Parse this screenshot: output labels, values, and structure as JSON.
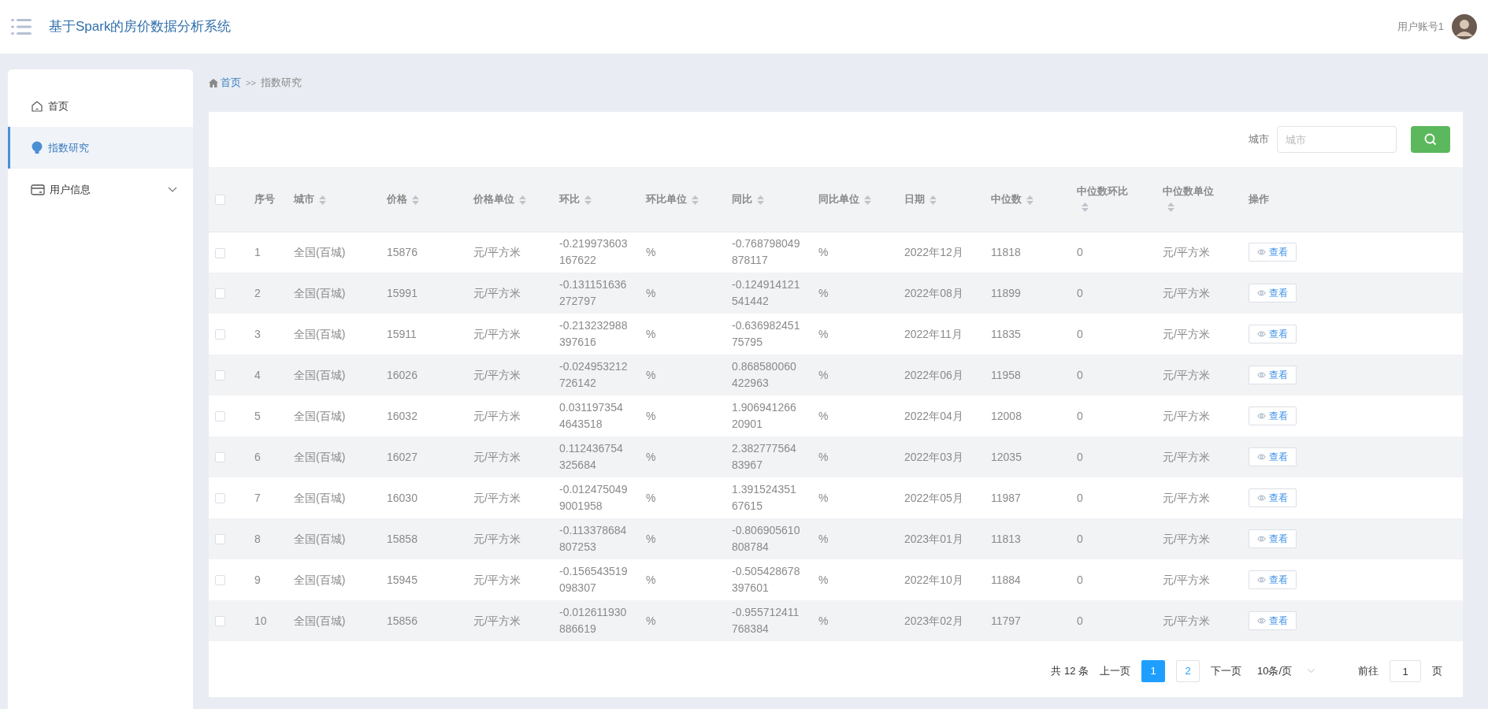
{
  "header": {
    "title": "基于Spark的房价数据分析系统",
    "user": "用户账号1"
  },
  "sidebar": {
    "items": [
      {
        "label": "首页",
        "selected": false
      },
      {
        "label": "指数研究",
        "selected": true
      },
      {
        "label": "用户信息",
        "selected": false,
        "expanded": false
      }
    ]
  },
  "breadcrumb": [
    {
      "label": "首页",
      "kind": "link"
    },
    {
      "label": "指数研究",
      "kind": "current"
    }
  ],
  "breadcrumb_separator": ">>",
  "search": {
    "label": "城市",
    "placeholder": "城市"
  },
  "table": {
    "all_checked": false,
    "columns": [
      {
        "label": "序号",
        "sortable": false
      },
      {
        "label": "城市",
        "sortable": true
      },
      {
        "label": "价格",
        "sortable": true
      },
      {
        "label": "价格单位",
        "sortable": true
      },
      {
        "label": "环比",
        "sortable": true
      },
      {
        "label": "环比单位",
        "sortable": true
      },
      {
        "label": "同比",
        "sortable": true
      },
      {
        "label": "同比单位",
        "sortable": true
      },
      {
        "label": "日期",
        "sortable": true
      },
      {
        "label": "中位数",
        "sortable": true
      },
      {
        "label": "中位数环比",
        "sortable": true
      },
      {
        "label": "中位数单位",
        "sortable": true
      },
      {
        "label": "操作",
        "sortable": false
      }
    ],
    "rows": [
      {
        "checked": false,
        "cells": [
          "1",
          "全国(百城)",
          "15876",
          "元/平方米",
          "-0.219973603167622",
          "%",
          "-0.768798049878117",
          "%",
          "2022年12月",
          "11818",
          "0",
          "元/平方米"
        ],
        "action": "查看"
      },
      {
        "checked": false,
        "cells": [
          "2",
          "全国(百城)",
          "15991",
          "元/平方米",
          "-0.131151636272797",
          "%",
          "-0.124914121541442",
          "%",
          "2022年08月",
          "11899",
          "0",
          "元/平方米"
        ],
        "action": "查看"
      },
      {
        "checked": false,
        "cells": [
          "3",
          "全国(百城)",
          "15911",
          "元/平方米",
          "-0.213232988397616",
          "%",
          "-0.63698245175795",
          "%",
          "2022年11月",
          "11835",
          "0",
          "元/平方米"
        ],
        "action": "查看"
      },
      {
        "checked": false,
        "cells": [
          "4",
          "全国(百城)",
          "16026",
          "元/平方米",
          "-0.024953212726142",
          "%",
          "0.868580060422963",
          "%",
          "2022年06月",
          "11958",
          "0",
          "元/平方米"
        ],
        "action": "查看"
      },
      {
        "checked": false,
        "cells": [
          "5",
          "全国(百城)",
          "16032",
          "元/平方米",
          "0.0311973544643518",
          "%",
          "1.90694126620901",
          "%",
          "2022年04月",
          "12008",
          "0",
          "元/平方米"
        ],
        "action": "查看"
      },
      {
        "checked": false,
        "cells": [
          "6",
          "全国(百城)",
          "16027",
          "元/平方米",
          "0.112436754325684",
          "%",
          "2.38277756483967",
          "%",
          "2022年03月",
          "12035",
          "0",
          "元/平方米"
        ],
        "action": "查看"
      },
      {
        "checked": false,
        "cells": [
          "7",
          "全国(百城)",
          "16030",
          "元/平方米",
          "-0.0124750499001958",
          "%",
          "1.39152435167615",
          "%",
          "2022年05月",
          "11987",
          "0",
          "元/平方米"
        ],
        "action": "查看"
      },
      {
        "checked": false,
        "cells": [
          "8",
          "全国(百城)",
          "15858",
          "元/平方米",
          "-0.113378684807253",
          "%",
          "-0.806905610808784",
          "%",
          "2023年01月",
          "11813",
          "0",
          "元/平方米"
        ],
        "action": "查看"
      },
      {
        "checked": false,
        "cells": [
          "9",
          "全国(百城)",
          "15945",
          "元/平方米",
          "-0.156543519098307",
          "%",
          "-0.505428678397601",
          "%",
          "2022年10月",
          "11884",
          "0",
          "元/平方米"
        ],
        "action": "查看"
      },
      {
        "checked": false,
        "cells": [
          "10",
          "全国(百城)",
          "15856",
          "元/平方米",
          "-0.012611930886619",
          "%",
          "-0.955712411768384",
          "%",
          "2023年02月",
          "11797",
          "0",
          "元/平方米"
        ],
        "action": "查看"
      }
    ]
  },
  "pagination": {
    "total": "共 12 条",
    "prev": "上一页",
    "pages": [
      {
        "label": "1",
        "selected": true
      },
      {
        "label": "2",
        "selected": false
      }
    ],
    "next": "下一页",
    "page_size": "10条/页",
    "goto_label": "前往",
    "goto_value": "1",
    "goto_suffix": "页"
  }
}
